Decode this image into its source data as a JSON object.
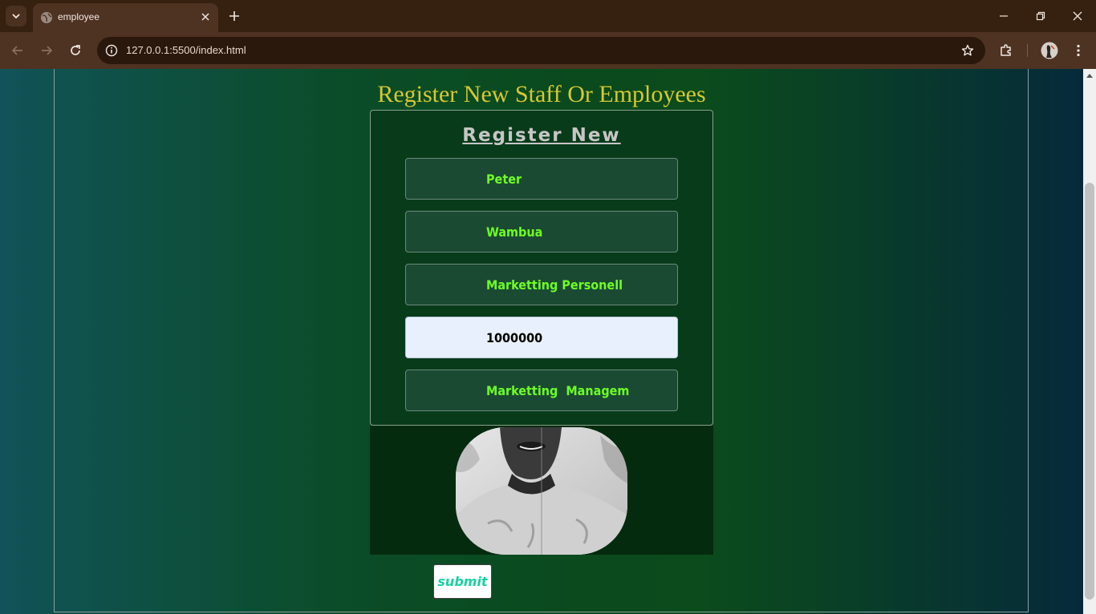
{
  "browser": {
    "tab_title": "employee",
    "url": "127.0.0.1:5500/index.html"
  },
  "page": {
    "heading": "Register New Staff Or Employees",
    "form_title": "Register New",
    "fields": [
      {
        "value": "Peter"
      },
      {
        "value": "Wambua"
      },
      {
        "value": "Marketting Personell"
      },
      {
        "value": "1000000"
      },
      {
        "value": "Marketting  Managem"
      }
    ],
    "submit_label": "submit"
  },
  "colors": {
    "heading": "#d6c832",
    "field_text": "#6dff24",
    "submit_text": "#18d0a0"
  }
}
